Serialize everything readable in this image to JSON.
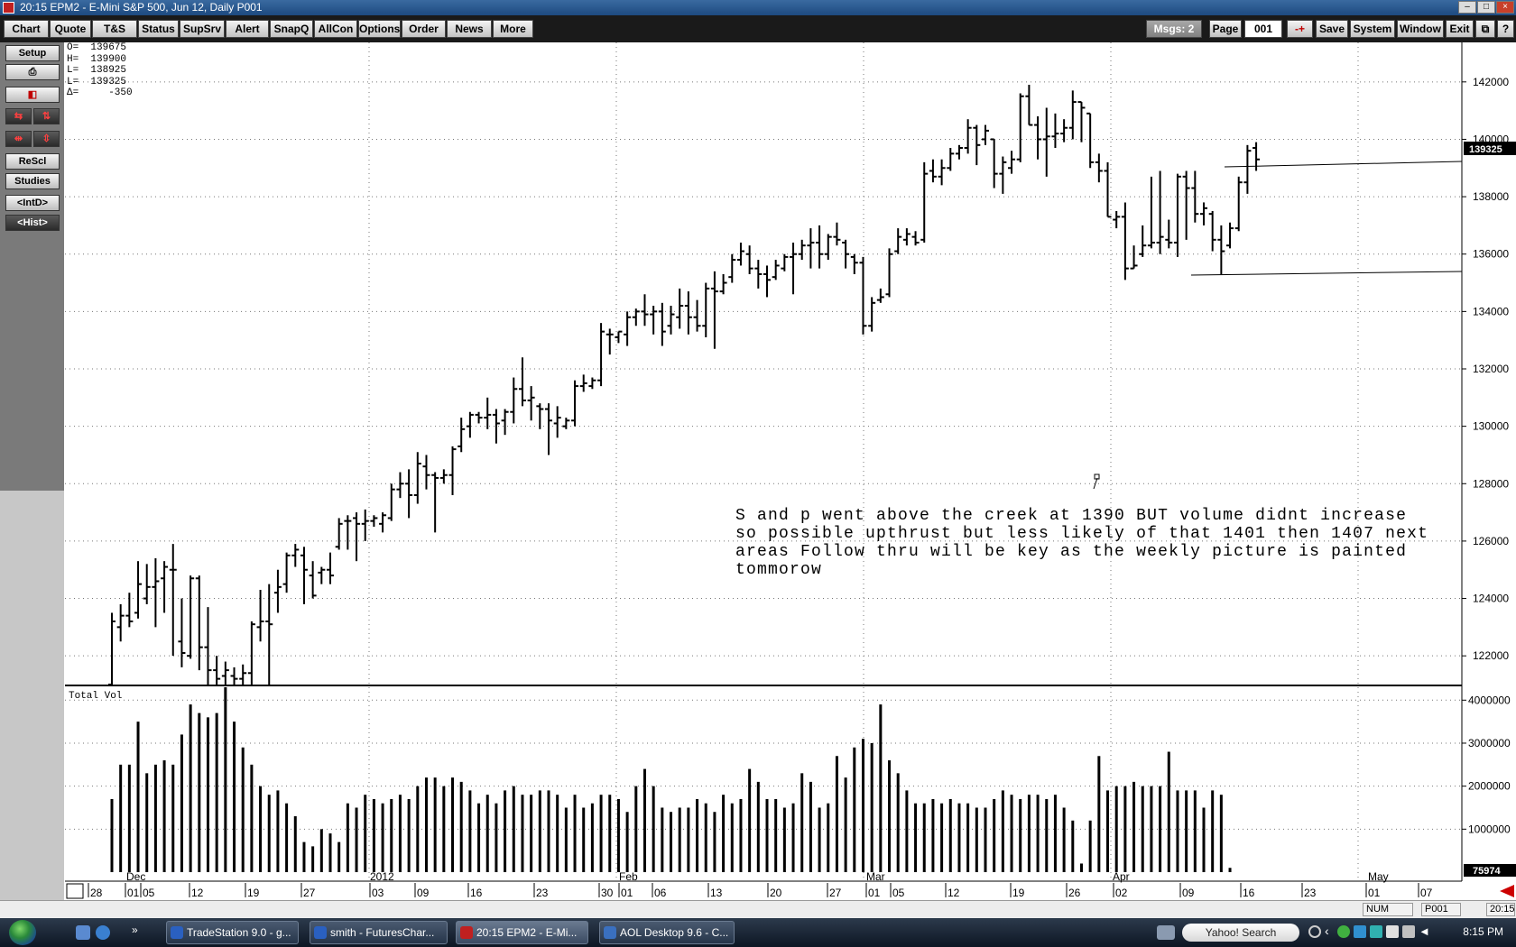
{
  "window": {
    "title": "20:15  EPM2 - E-Mini S&P 500, Jun 12, Daily   P001"
  },
  "toolbar": {
    "buttons": [
      "Chart",
      "Quote",
      "T&S",
      "Status",
      "SupSrv",
      "Alert",
      "SnapQ",
      "AllCon",
      "Options",
      "Order",
      "News",
      "More"
    ],
    "msgs": "Msgs: 2",
    "page_label": "Page",
    "page_value": "001",
    "page_step": "-+",
    "right_buttons": [
      "Save",
      "System",
      "Window",
      "Exit"
    ],
    "restore_icon": "restore-icon",
    "help": "?"
  },
  "left_panel": {
    "setup": "Setup",
    "print_icon": "printer-icon",
    "chart_icon": "chart-type-icon",
    "rescale": "ReScl",
    "studies": "Studies",
    "intd": "<IntD>",
    "hist": "<Hist>"
  },
  "ohlc": {
    "lines": [
      "O=  139675",
      "H=  139900",
      "L=  138925",
      "L=  139325",
      "Δ=     -350"
    ]
  },
  "annotation": {
    "text": "S and p went above the creek at 1390 BUT volume didnt increase so possible upthrust but less likely of that 1401 then 1407 next areas Follow thru will be key as the weekly picture is painted tommorow"
  },
  "chart_data": [
    {
      "type": "ohlc",
      "ylim": [
        121000,
        143000
      ],
      "yticks": [
        122000,
        124000,
        126000,
        128000,
        130000,
        132000,
        134000,
        136000,
        138000,
        140000,
        142000
      ],
      "last_price_label": "139325",
      "x_labels": [
        "28",
        "Dec",
        "01",
        "05",
        "12",
        "19",
        "27",
        "2012",
        "03",
        "09",
        "16",
        "23",
        "30",
        "Feb",
        "01",
        "06",
        "13",
        "20",
        "27",
        "Mar",
        "01",
        "05",
        "12",
        "19",
        "26",
        "Apr",
        "02",
        "09",
        "16",
        "23",
        "May",
        "01",
        "07"
      ],
      "bars": [
        {
          "h": 123500,
          "l": 121000,
          "o": 121000,
          "c": 123200
        },
        {
          "h": 123800,
          "l": 122500,
          "o": 123000,
          "c": 123400
        },
        {
          "h": 124200,
          "l": 123000,
          "o": 123400,
          "c": 123200
        },
        {
          "h": 125300,
          "l": 123300,
          "o": 123500,
          "c": 124500
        },
        {
          "h": 125200,
          "l": 123800,
          "o": 124000,
          "c": 124400
        },
        {
          "h": 125400,
          "l": 123000,
          "o": 124400,
          "c": 124600
        },
        {
          "h": 125300,
          "l": 123500,
          "o": 124700,
          "c": 125100
        },
        {
          "h": 125900,
          "l": 122000,
          "o": 125000,
          "c": 125000
        },
        {
          "h": 124000,
          "l": 121600,
          "o": 122500,
          "c": 122100
        },
        {
          "h": 124800,
          "l": 121900,
          "o": 122000,
          "c": 124700
        },
        {
          "h": 124800,
          "l": 121500,
          "o": 124700,
          "c": 122300
        },
        {
          "h": 123700,
          "l": 121000,
          "o": 122300,
          "c": 121500
        },
        {
          "h": 122000,
          "l": 121000,
          "o": 121500,
          "c": 121200
        },
        {
          "h": 121800,
          "l": 121000,
          "o": 121300,
          "c": 121500
        },
        {
          "h": 121600,
          "l": 121000,
          "o": 121300,
          "c": 121200
        },
        {
          "h": 121700,
          "l": 121000,
          "o": 121200,
          "c": 121400
        },
        {
          "h": 123200,
          "l": 121000,
          "o": 121400,
          "c": 123100
        },
        {
          "h": 124300,
          "l": 122500,
          "o": 123000,
          "c": 123200
        },
        {
          "h": 124500,
          "l": 121000,
          "o": 123200,
          "c": 123100
        },
        {
          "h": 125000,
          "l": 123500,
          "o": 124200,
          "c": 124400
        },
        {
          "h": 125600,
          "l": 124200,
          "o": 124500,
          "c": 125500
        },
        {
          "h": 125900,
          "l": 125100,
          "o": 125500,
          "c": 125700
        },
        {
          "h": 125800,
          "l": 123800,
          "o": 125500,
          "c": 125000
        },
        {
          "h": 125300,
          "l": 124000,
          "o": 124800,
          "c": 124100
        },
        {
          "h": 125100,
          "l": 124500,
          "o": 124900,
          "c": 125000
        },
        {
          "h": 125600,
          "l": 124500,
          "o": 125000,
          "c": 124800
        },
        {
          "h": 126800,
          "l": 125700,
          "o": 125800,
          "c": 126600
        },
        {
          "h": 126900,
          "l": 125700,
          "o": 126700,
          "c": 126700
        },
        {
          "h": 127000,
          "l": 125300,
          "o": 126800,
          "c": 126600
        },
        {
          "h": 127100,
          "l": 126000,
          "o": 126600,
          "c": 126700
        },
        {
          "h": 126900,
          "l": 126500,
          "o": 126700,
          "c": 126800
        },
        {
          "h": 127000,
          "l": 126300,
          "o": 126600,
          "c": 126900
        },
        {
          "h": 128000,
          "l": 126700,
          "o": 126800,
          "c": 127800
        },
        {
          "h": 128400,
          "l": 127500,
          "o": 127800,
          "c": 128000
        },
        {
          "h": 128500,
          "l": 126800,
          "o": 128000,
          "c": 127600
        },
        {
          "h": 129100,
          "l": 127300,
          "o": 127600,
          "c": 128700
        },
        {
          "h": 129000,
          "l": 127800,
          "o": 128600,
          "c": 128300
        },
        {
          "h": 128400,
          "l": 126300,
          "o": 128300,
          "c": 128200
        },
        {
          "h": 128500,
          "l": 128000,
          "o": 128200,
          "c": 128300
        },
        {
          "h": 129300,
          "l": 127600,
          "o": 128300,
          "c": 129200
        },
        {
          "h": 130300,
          "l": 129100,
          "o": 129300,
          "c": 129900
        },
        {
          "h": 130500,
          "l": 129600,
          "o": 130000,
          "c": 130400
        },
        {
          "h": 130500,
          "l": 130100,
          "o": 130400,
          "c": 130300
        },
        {
          "h": 131000,
          "l": 129900,
          "o": 130300,
          "c": 130400
        },
        {
          "h": 130600,
          "l": 129400,
          "o": 130400,
          "c": 130100
        },
        {
          "h": 130600,
          "l": 129700,
          "o": 130200,
          "c": 130500
        },
        {
          "h": 131700,
          "l": 130100,
          "o": 130500,
          "c": 131300
        },
        {
          "h": 132400,
          "l": 130700,
          "o": 131300,
          "c": 130900
        },
        {
          "h": 131400,
          "l": 130200,
          "o": 130900,
          "c": 131000
        },
        {
          "h": 130800,
          "l": 129900,
          "o": 130700,
          "c": 130600
        },
        {
          "h": 130800,
          "l": 129000,
          "o": 130600,
          "c": 130200
        },
        {
          "h": 130700,
          "l": 129600,
          "o": 130100,
          "c": 130300
        },
        {
          "h": 130300,
          "l": 129900,
          "o": 130000,
          "c": 130200
        },
        {
          "h": 131600,
          "l": 130000,
          "o": 130200,
          "c": 131400
        },
        {
          "h": 131800,
          "l": 131200,
          "o": 131400,
          "c": 131500
        },
        {
          "h": 131700,
          "l": 131300,
          "o": 131400,
          "c": 131600
        },
        {
          "h": 133600,
          "l": 131400,
          "o": 131600,
          "c": 133300
        },
        {
          "h": 133400,
          "l": 132500,
          "o": 133200,
          "c": 133200
        },
        {
          "h": 133300,
          "l": 132900,
          "o": 133100,
          "c": 133300
        },
        {
          "h": 134000,
          "l": 132800,
          "o": 133200,
          "c": 133800
        },
        {
          "h": 134100,
          "l": 133500,
          "o": 133800,
          "c": 134000
        },
        {
          "h": 134600,
          "l": 133500,
          "o": 134000,
          "c": 133900
        },
        {
          "h": 134200,
          "l": 133200,
          "o": 133900,
          "c": 134000
        },
        {
          "h": 134300,
          "l": 132800,
          "o": 134000,
          "c": 133300
        },
        {
          "h": 134200,
          "l": 133200,
          "o": 133500,
          "c": 133900
        },
        {
          "h": 134800,
          "l": 133400,
          "o": 133800,
          "c": 134200
        },
        {
          "h": 134700,
          "l": 133200,
          "o": 134200,
          "c": 133800
        },
        {
          "h": 134400,
          "l": 133300,
          "o": 133800,
          "c": 133500
        },
        {
          "h": 135000,
          "l": 133100,
          "o": 133500,
          "c": 134800
        },
        {
          "h": 135400,
          "l": 132700,
          "o": 134800,
          "c": 134700
        },
        {
          "h": 135300,
          "l": 134600,
          "o": 134700,
          "c": 135000
        },
        {
          "h": 136000,
          "l": 135000,
          "o": 135200,
          "c": 135800
        },
        {
          "h": 136400,
          "l": 135600,
          "o": 135800,
          "c": 136100
        },
        {
          "h": 136300,
          "l": 135300,
          "o": 136000,
          "c": 135500
        },
        {
          "h": 135800,
          "l": 134800,
          "o": 135500,
          "c": 135300
        },
        {
          "h": 135600,
          "l": 134500,
          "o": 135300,
          "c": 135100
        },
        {
          "h": 135800,
          "l": 135100,
          "o": 135200,
          "c": 135600
        },
        {
          "h": 136000,
          "l": 135400,
          "o": 135500,
          "c": 135900
        },
        {
          "h": 136400,
          "l": 134600,
          "o": 135900,
          "c": 136000
        },
        {
          "h": 136500,
          "l": 135800,
          "o": 136000,
          "c": 136300
        },
        {
          "h": 136900,
          "l": 135500,
          "o": 136300,
          "c": 136400
        },
        {
          "h": 137000,
          "l": 135500,
          "o": 136400,
          "c": 136000
        },
        {
          "h": 136700,
          "l": 135800,
          "o": 136000,
          "c": 136600
        },
        {
          "h": 137100,
          "l": 136300,
          "o": 136600,
          "c": 136500
        },
        {
          "h": 136500,
          "l": 135500,
          "o": 136400,
          "c": 136000
        },
        {
          "h": 136000,
          "l": 135300,
          "o": 135900,
          "c": 135700
        },
        {
          "h": 135900,
          "l": 133200,
          "o": 135700,
          "c": 133500
        },
        {
          "h": 134500,
          "l": 133300,
          "o": 133500,
          "c": 134300
        },
        {
          "h": 134800,
          "l": 134300,
          "o": 134400,
          "c": 134500
        },
        {
          "h": 136200,
          "l": 134500,
          "o": 134600,
          "c": 136000
        },
        {
          "h": 136900,
          "l": 136000,
          "o": 136100,
          "c": 136600
        },
        {
          "h": 136900,
          "l": 136300,
          "o": 136500,
          "c": 136700
        },
        {
          "h": 136800,
          "l": 136300,
          "o": 136600,
          "c": 136400
        },
        {
          "h": 139200,
          "l": 136400,
          "o": 136500,
          "c": 138800
        },
        {
          "h": 139300,
          "l": 138500,
          "o": 138900,
          "c": 138700
        },
        {
          "h": 139300,
          "l": 138400,
          "o": 138700,
          "c": 139000
        },
        {
          "h": 139700,
          "l": 138900,
          "o": 139000,
          "c": 139500
        },
        {
          "h": 139800,
          "l": 139300,
          "o": 139500,
          "c": 139700
        },
        {
          "h": 140700,
          "l": 139500,
          "o": 139700,
          "c": 140400
        },
        {
          "h": 140500,
          "l": 139100,
          "o": 140400,
          "c": 139800
        },
        {
          "h": 140500,
          "l": 139800,
          "o": 140000,
          "c": 140300
        },
        {
          "h": 140000,
          "l": 138300,
          "o": 140000,
          "c": 138800
        },
        {
          "h": 139400,
          "l": 138100,
          "o": 138800,
          "c": 139200
        },
        {
          "h": 139600,
          "l": 138800,
          "o": 139000,
          "c": 139300
        },
        {
          "h": 141600,
          "l": 139200,
          "o": 139300,
          "c": 141500
        },
        {
          "h": 141900,
          "l": 140500,
          "o": 141500,
          "c": 140500
        },
        {
          "h": 140800,
          "l": 139300,
          "o": 140500,
          "c": 140000
        },
        {
          "h": 141100,
          "l": 138700,
          "o": 140000,
          "c": 140100
        },
        {
          "h": 140900,
          "l": 139700,
          "o": 140100,
          "c": 140200
        },
        {
          "h": 140700,
          "l": 139900,
          "o": 140200,
          "c": 140400
        },
        {
          "h": 141700,
          "l": 140000,
          "o": 140400,
          "c": 141300
        },
        {
          "h": 141300,
          "l": 139900,
          "o": 141300,
          "c": 141100
        },
        {
          "h": 140900,
          "l": 139000,
          "o": 140900,
          "c": 139200
        },
        {
          "h": 139500,
          "l": 138500,
          "o": 139200,
          "c": 138900
        },
        {
          "h": 139200,
          "l": 137300,
          "o": 138900,
          "c": 137300
        },
        {
          "h": 137500,
          "l": 136900,
          "o": 137200,
          "c": 137300
        },
        {
          "h": 137800,
          "l": 135100,
          "o": 137300,
          "c": 135500
        },
        {
          "h": 136300,
          "l": 135500,
          "o": 135500,
          "c": 135600
        },
        {
          "h": 137000,
          "l": 135900,
          "o": 136000,
          "c": 136300
        },
        {
          "h": 138700,
          "l": 136200,
          "o": 136300,
          "c": 136400
        },
        {
          "h": 138900,
          "l": 136000,
          "o": 136400,
          "c": 136600
        },
        {
          "h": 137200,
          "l": 136200,
          "o": 136500,
          "c": 136400
        },
        {
          "h": 138800,
          "l": 135900,
          "o": 136400,
          "c": 138700
        },
        {
          "h": 138900,
          "l": 136500,
          "o": 138700,
          "c": 138300
        },
        {
          "h": 138900,
          "l": 137100,
          "o": 138300,
          "c": 137400
        },
        {
          "h": 137800,
          "l": 137000,
          "o": 137400,
          "c": 137600
        },
        {
          "h": 137500,
          "l": 136100,
          "o": 137400,
          "c": 136500
        },
        {
          "h": 137000,
          "l": 135300,
          "o": 136500,
          "c": 136100
        },
        {
          "h": 137100,
          "l": 136200,
          "o": 136300,
          "c": 136900
        },
        {
          "h": 138700,
          "l": 136800,
          "o": 136900,
          "c": 138500
        },
        {
          "h": 139800,
          "l": 138100,
          "o": 138500,
          "c": 139600
        },
        {
          "h": 139900,
          "l": 138900,
          "o": 139700,
          "c": 139300
        }
      ]
    },
    {
      "type": "bar",
      "title": "Total Vol",
      "ylim": [
        0,
        4300000
      ],
      "yticks": [
        1000000,
        2000000,
        3000000,
        4000000
      ],
      "last_value_label": "75974",
      "values": [
        1700000,
        2500000,
        2500000,
        3500000,
        2300000,
        2500000,
        2600000,
        2500000,
        3200000,
        3900000,
        3700000,
        3600000,
        3700000,
        4300000,
        3500000,
        2900000,
        2500000,
        2000000,
        1800000,
        1900000,
        1600000,
        1300000,
        700000,
        600000,
        1000000,
        900000,
        700000,
        1600000,
        1500000,
        1800000,
        1700000,
        1600000,
        1700000,
        1800000,
        1700000,
        2000000,
        2200000,
        2200000,
        2000000,
        2200000,
        2100000,
        1900000,
        1600000,
        1800000,
        1600000,
        1900000,
        2000000,
        1800000,
        1800000,
        1900000,
        1900000,
        1800000,
        1500000,
        1800000,
        1500000,
        1600000,
        1800000,
        1800000,
        1700000,
        1400000,
        2000000,
        2400000,
        2000000,
        1500000,
        1400000,
        1500000,
        1500000,
        1700000,
        1600000,
        1400000,
        1800000,
        1600000,
        1700000,
        2400000,
        2100000,
        1700000,
        1700000,
        1500000,
        1600000,
        2300000,
        2100000,
        1500000,
        1600000,
        2700000,
        2200000,
        2900000,
        3100000,
        3000000,
        3900000,
        2600000,
        2300000,
        1900000,
        1600000,
        1600000,
        1700000,
        1600000,
        1700000,
        1600000,
        1600000,
        1500000,
        1500000,
        1700000,
        1900000,
        1800000,
        1700000,
        1800000,
        1800000,
        1700000,
        1800000,
        1500000,
        1200000,
        200000,
        1200000,
        2700000,
        1900000,
        2000000,
        2000000,
        2100000,
        2000000,
        2000000,
        2000000,
        2800000,
        1900000,
        1900000,
        1900000,
        1500000,
        1900000,
        1800000,
        100000
      ]
    }
  ],
  "status": {
    "num": "NUM",
    "page": "P001",
    "time": "20:15"
  },
  "taskbar": {
    "tasks": [
      "TradeStation 9.0 - g...",
      "smith - FuturesChar...",
      "20:15  EPM2 - E-Mi...",
      "AOL Desktop 9.6 - C..."
    ],
    "search": "Yahoo! Search",
    "clock": "8:15 PM",
    "colors": {
      "bar": "#000000",
      "grid_dot": "#5a5a5a",
      "last_price_bg": "#000000"
    }
  }
}
